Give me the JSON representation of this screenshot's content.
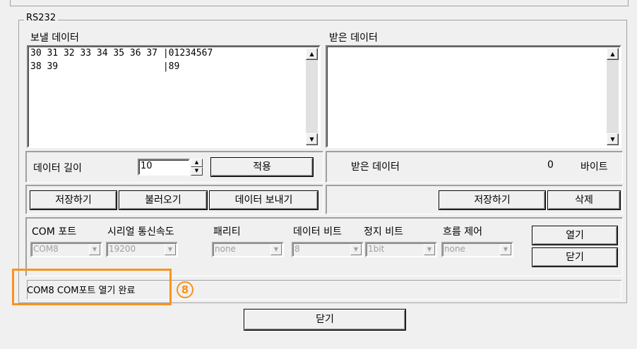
{
  "group": {
    "title": "RS232"
  },
  "send": {
    "label": "보낼 데이터",
    "lines": [
      "30 31 32 33 34 35 36 37 |01234567",
      "38 39                   |89"
    ]
  },
  "recv": {
    "label": "받은 데이터",
    "content": ""
  },
  "length": {
    "label": "데이터 길이",
    "value": "10",
    "apply": "적용"
  },
  "received": {
    "label": "받은 데이터",
    "count": "0",
    "unit": "바이트"
  },
  "send_buttons": {
    "save": "저장하기",
    "load": "불러오기",
    "send": "데이터 보내기"
  },
  "recv_buttons": {
    "save": "저장하기",
    "delete": "삭제"
  },
  "settings": {
    "port_label": "COM 포트",
    "port_value": "COM8",
    "baud_label": "시리얼 통신속도",
    "baud_value": "19200",
    "parity_label": "패리티",
    "parity_value": "none",
    "databits_label": "데이터 비트",
    "databits_value": "8",
    "stopbits_label": "정지 비트",
    "stopbits_value": "1bit",
    "flow_label": "흐름 제어",
    "flow_value": "none",
    "open": "열기",
    "close": "닫기"
  },
  "status": {
    "text": "COM8 COM포트 열기 완료"
  },
  "annotation": {
    "number": "8",
    "color": "#f7941d"
  },
  "footer": {
    "close": "닫기"
  },
  "icons": {
    "up": "scroll-up-arrow",
    "down": "scroll-down-arrow",
    "dropdown": "chevron-down",
    "spin": "spin-up-down"
  }
}
